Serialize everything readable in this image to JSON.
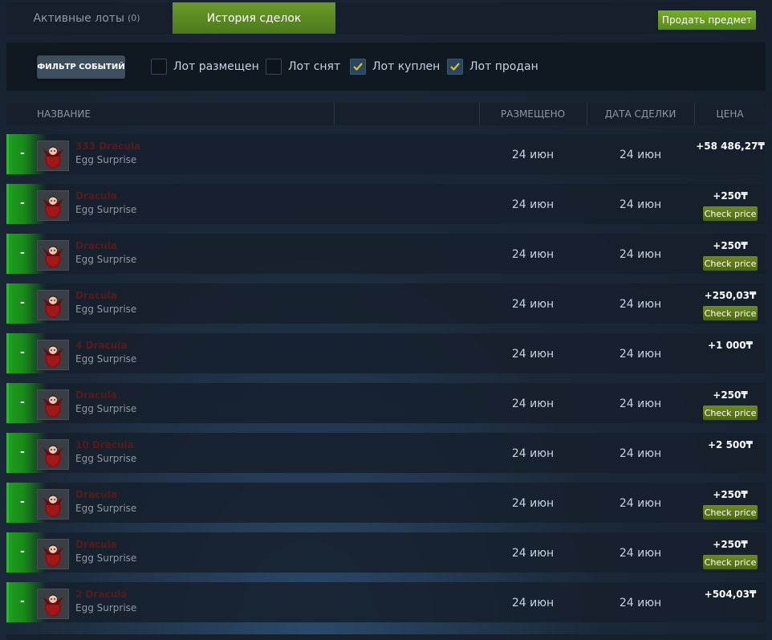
{
  "tabs": {
    "active_listings_label": "Активные лоты",
    "active_listings_count": "(0)",
    "history_label": "История сделок"
  },
  "sell_button_label": "Продать предмет",
  "filter": {
    "button_label": "ФИЛЬТР СОБЫТИЙ",
    "options": [
      {
        "label": "Лот размещен",
        "checked": false
      },
      {
        "label": "Лот снят",
        "checked": false
      },
      {
        "label": "Лот куплен",
        "checked": true
      },
      {
        "label": "Лот продан",
        "checked": true
      }
    ]
  },
  "table": {
    "headers": {
      "name": "НАЗВАНИЕ",
      "listed": "РАЗМЕЩЕНО",
      "deal_date": "ДАТА СДЕЛКИ",
      "price": "ЦЕНА"
    },
    "check_price_label": "Check price",
    "rows": [
      {
        "sign": "-",
        "name": "333 Dracula",
        "game": "Egg Surprise",
        "listed": "24 июн",
        "deal_date": "24 июн",
        "price": "+58 486,27₸",
        "check_price": false
      },
      {
        "sign": "-",
        "name": "Dracula",
        "game": "Egg Surprise",
        "listed": "24 июн",
        "deal_date": "24 июн",
        "price": "+250₸",
        "check_price": true
      },
      {
        "sign": "-",
        "name": "Dracula",
        "game": "Egg Surprise",
        "listed": "24 июн",
        "deal_date": "24 июн",
        "price": "+250₸",
        "check_price": true
      },
      {
        "sign": "-",
        "name": "Dracula",
        "game": "Egg Surprise",
        "listed": "24 июн",
        "deal_date": "24 июн",
        "price": "+250,03₸",
        "check_price": true
      },
      {
        "sign": "-",
        "name": "4 Dracula",
        "game": "Egg Surprise",
        "listed": "24 июн",
        "deal_date": "24 июн",
        "price": "+1 000₸",
        "check_price": false
      },
      {
        "sign": "-",
        "name": "Dracula",
        "game": "Egg Surprise",
        "listed": "24 июн",
        "deal_date": "24 июн",
        "price": "+250₸",
        "check_price": true
      },
      {
        "sign": "-",
        "name": "10 Dracula",
        "game": "Egg Surprise",
        "listed": "24 июн",
        "deal_date": "24 июн",
        "price": "+2 500₸",
        "check_price": false
      },
      {
        "sign": "-",
        "name": "Dracula",
        "game": "Egg Surprise",
        "listed": "24 июн",
        "deal_date": "24 июн",
        "price": "+250₸",
        "check_price": true
      },
      {
        "sign": "-",
        "name": "Dracula",
        "game": "Egg Surprise",
        "listed": "24 июн",
        "deal_date": "24 июн",
        "price": "+250₸",
        "check_price": true
      },
      {
        "sign": "-",
        "name": "2 Dracula",
        "game": "Egg Surprise",
        "listed": "24 июн",
        "deal_date": "24 июн",
        "price": "+504,03₸",
        "check_price": false
      }
    ]
  },
  "colors": {
    "accent_green": "#75b022",
    "row_indicator_green": "#1e9e1e",
    "background": "#1b2838"
  }
}
